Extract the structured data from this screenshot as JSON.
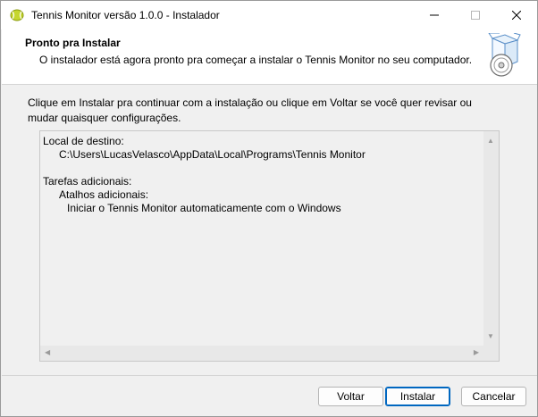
{
  "window": {
    "title": "Tennis Monitor versão 1.0.0 - Instalador",
    "controls": {
      "minimize": "—",
      "maximize": "☐",
      "close": "✕"
    }
  },
  "header": {
    "title": "Pronto pra Instalar",
    "subtitle": "O instalador está agora pronto pra começar a instalar o Tennis Monitor no seu computador."
  },
  "instructions": "Clique em Instalar pra continuar com a instalação ou clique em Voltar se você quer revisar ou mudar quaisquer configurações.",
  "memo": {
    "destination_label": "Local de destino:",
    "destination_path": "C:\\Users\\LucasVelasco\\AppData\\Local\\Programs\\Tennis Monitor",
    "tasks_label": "Tarefas adicionais:",
    "tasks_group": "Atalhos adicionais:",
    "tasks_item": "Iniciar o Tennis Monitor automaticamente com o Windows"
  },
  "buttons": {
    "back": "Voltar",
    "install": "Instalar",
    "cancel": "Cancelar"
  },
  "colors": {
    "accent": "#0067c0",
    "background": "#f0f0f0",
    "app_icon": "#c5d62e"
  },
  "icons": {
    "app": "tennis-ball-icon",
    "header": "installer-box-disc-icon"
  }
}
